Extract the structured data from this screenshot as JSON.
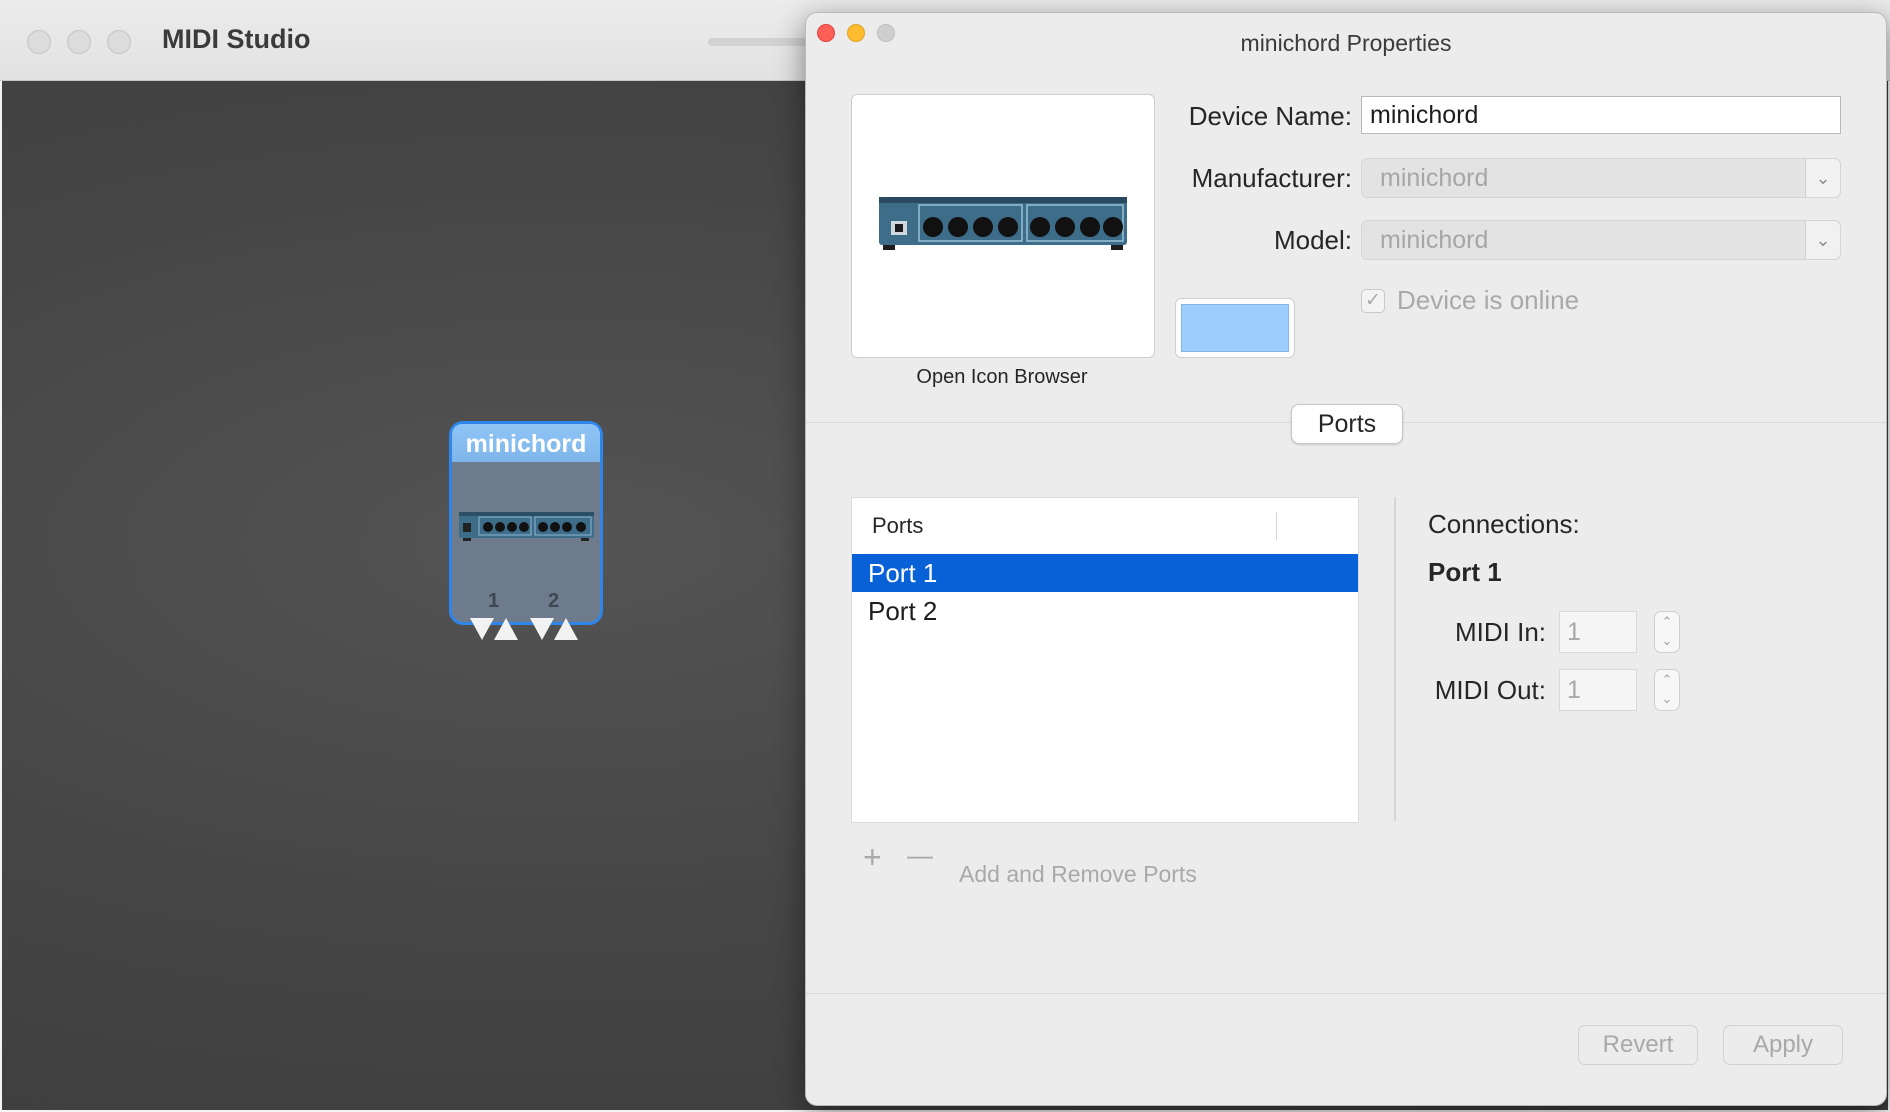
{
  "main_window": {
    "title": "MIDI Studio",
    "device_node": {
      "name": "minichord",
      "ports": [
        "1",
        "2"
      ]
    }
  },
  "properties_panel": {
    "title": "minichord Properties",
    "icon_browser_caption": "Open Icon Browser",
    "device_name": {
      "label": "Device Name:",
      "value": "minichord"
    },
    "manufacturer": {
      "label": "Manufacturer:",
      "value": "minichord"
    },
    "model": {
      "label": "Model:",
      "value": "minichord"
    },
    "online_checkbox": {
      "label": "Device is online",
      "checked": true
    },
    "device_color": "#9dcdfc",
    "section_button": "Ports",
    "ports_table": {
      "header": "Ports",
      "rows": [
        "Port 1",
        "Port 2"
      ],
      "selected_index": 0
    },
    "connections": {
      "heading": "Connections:",
      "port_name": "Port 1",
      "midi_in_label": "MIDI In:",
      "midi_in_value": "1",
      "midi_out_label": "MIDI Out:",
      "midi_out_value": "1"
    },
    "add_remove": {
      "add_symbol": "+",
      "remove_symbol": "—",
      "label": "Add and Remove Ports"
    },
    "buttons": {
      "revert": "Revert",
      "apply": "Apply"
    }
  },
  "colors": {
    "selection": "#0961d8",
    "node_border": "#2f86ea",
    "canvas": "#464646"
  }
}
